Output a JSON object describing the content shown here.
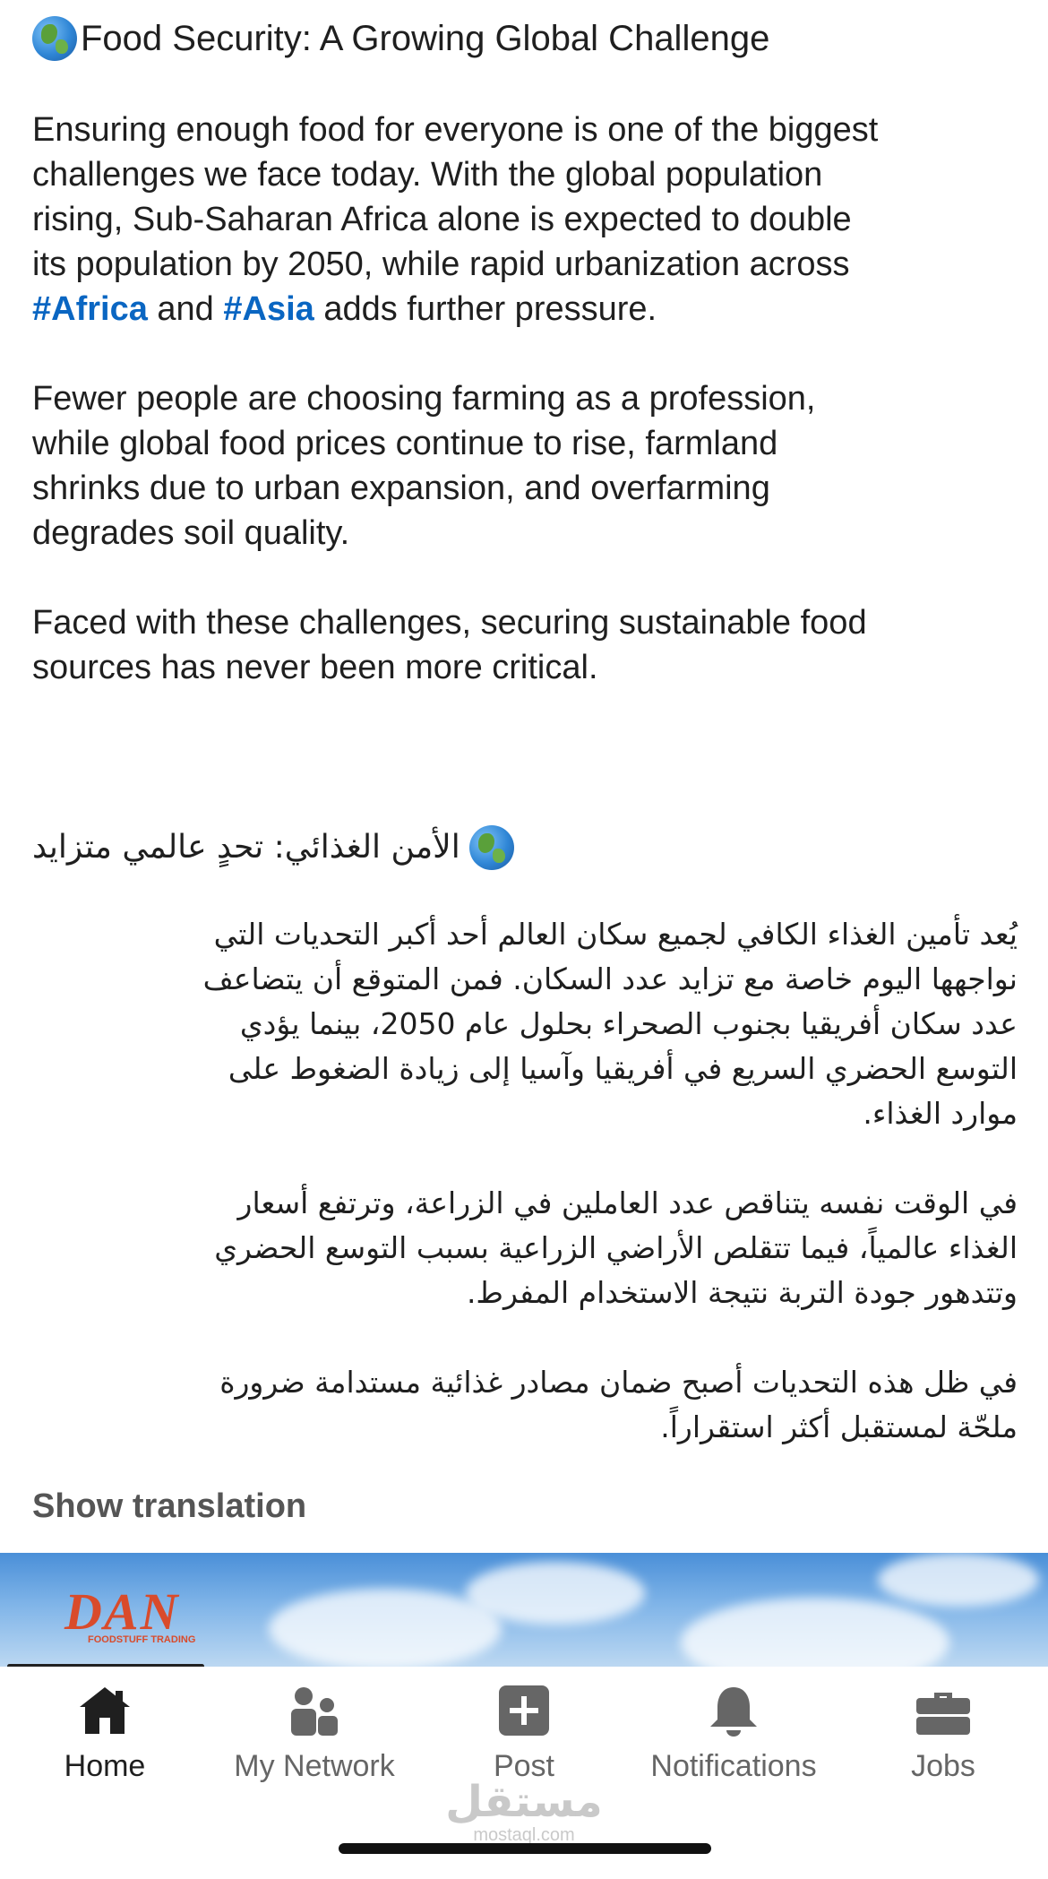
{
  "post": {
    "en_title": "Food Security: A Growing Global Challenge",
    "en_p1_lines": [
      "Ensuring enough food for everyone is one of the biggest",
      "challenges we face today. With the global population",
      "rising, Sub-Saharan Africa alone is expected to double",
      "its population by 2050, while rapid urbanization across"
    ],
    "en_p1_last": {
      "hashtag1": "#Africa",
      "and": " and ",
      "hashtag2": "#Asia",
      "rest": " adds further pressure."
    },
    "en_p2_lines": [
      "Fewer people are choosing farming as a profession,",
      "while global food prices continue to rise, farmland",
      "shrinks due to urban expansion, and overfarming",
      "degrades soil quality."
    ],
    "en_p3_lines": [
      "Faced with these challenges, securing sustainable food",
      "sources has never been more critical."
    ],
    "ar_title": "الأمن الغذائي: تحدٍ عالمي متزايد",
    "ar_p1_lines": [
      "يُعد تأمين الغذاء الكافي لجميع سكان العالم أحد أكبر التحديات التي",
      "نواجهها اليوم خاصة مع تزايد عدد السكان. فمن المتوقع أن يتضاعف",
      "عدد سكان أفريقيا بجنوب الصحراء بحلول عام 2050، بينما يؤدي",
      "التوسع الحضري السريع في أفريقيا وآسيا إلى زيادة الضغوط على",
      "موارد الغذاء."
    ],
    "ar_p2_lines": [
      "في الوقت نفسه يتناقص عدد العاملين في الزراعة، وترتفع أسعار",
      "الغذاء عالمياً، فيما تتقلص الأراضي الزراعية بسبب التوسع الحضري",
      "وتتدهور جودة التربة نتيجة الاستخدام المفرط."
    ],
    "ar_p3_lines": [
      "في ظل هذه التحديات أصبح ضمان مصادر غذائية مستدامة ضرورة",
      "ملحّة لمستقبل أكثر استقراراً."
    ],
    "show_translation": "Show translation"
  },
  "banner": {
    "logo_text": "DAN",
    "logo_sub": "FOODSTUFF TRADING"
  },
  "nav": {
    "items": [
      {
        "label": "Home",
        "icon": "home-icon"
      },
      {
        "label": "My Network",
        "icon": "network-icon"
      },
      {
        "label": "Post",
        "icon": "post-icon"
      },
      {
        "label": "Notifications",
        "icon": "bell-icon"
      },
      {
        "label": "Jobs",
        "icon": "briefcase-icon"
      }
    ]
  },
  "watermark": {
    "ar": "مستقل",
    "en": "mostaql.com"
  },
  "colors": {
    "hashtag": "#0a66c2",
    "nav_active": "#1f1f1f",
    "nav_inactive": "#666666"
  }
}
